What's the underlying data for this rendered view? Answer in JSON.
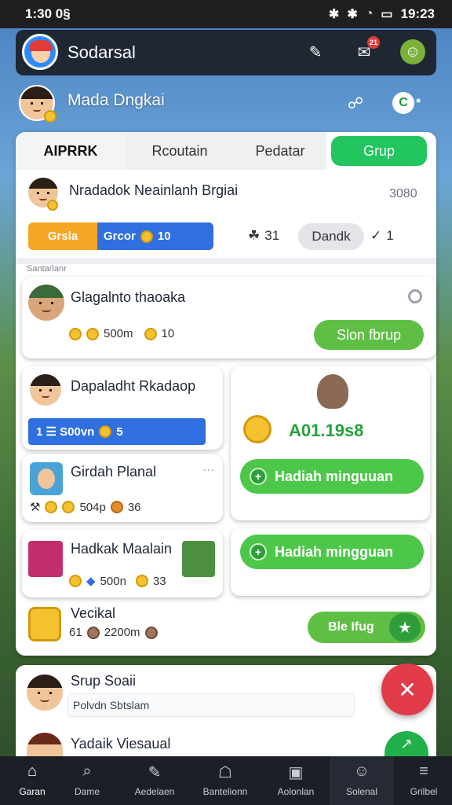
{
  "status_bar": {
    "time_left": "1:30 0§",
    "time_right": "19:23"
  },
  "header": {
    "app_name": "Sodarsal",
    "badge": "21"
  },
  "profile": {
    "name": "Mada Dngkai"
  },
  "tabs": [
    "AIPRRK",
    "Rcoutain",
    "Pedatar",
    "Grup"
  ],
  "featured": {
    "title": "Nradadok Neainlanh Brgiai",
    "score": "3080",
    "bar_left": "Grsla",
    "bar_right": "Grcor",
    "bar_value": "10",
    "people_count": "31",
    "action": "Dandk",
    "extra": "1"
  },
  "section_label": "Santarlanr",
  "item1": {
    "title": "Glagalnto thaoaka",
    "stat1": "500m",
    "stat2": "10",
    "button": "Slon fbrup"
  },
  "item2": {
    "title": "Dapaladht Rkadaop",
    "bar_text": "1 ☰ S00vn",
    "bar_value": "5"
  },
  "reward_card": {
    "amount": "A01.19s8",
    "button1": "Hadiah minguuan",
    "button2": "Hadiah mingguan"
  },
  "item3": {
    "title": "Girdah Planal",
    "stat1": "504p",
    "stat2": "36"
  },
  "item4": {
    "title": "Hadkak Maalain",
    "stat1": "500n",
    "stat2": "33"
  },
  "item5": {
    "title": "Vecikal",
    "stat_prefix": "61",
    "stat1": "2200m",
    "button": "Ble Ifug"
  },
  "lower_card": {
    "title": "Srup Soaii",
    "input_value": "Polvdn Sbtslam",
    "title2": "Yadaik Viesaual"
  },
  "nav": [
    "Garan",
    "Dame",
    "Aedelaen",
    "Bantelionn",
    "Aolonlan",
    "Solenal",
    "Grilbel"
  ]
}
